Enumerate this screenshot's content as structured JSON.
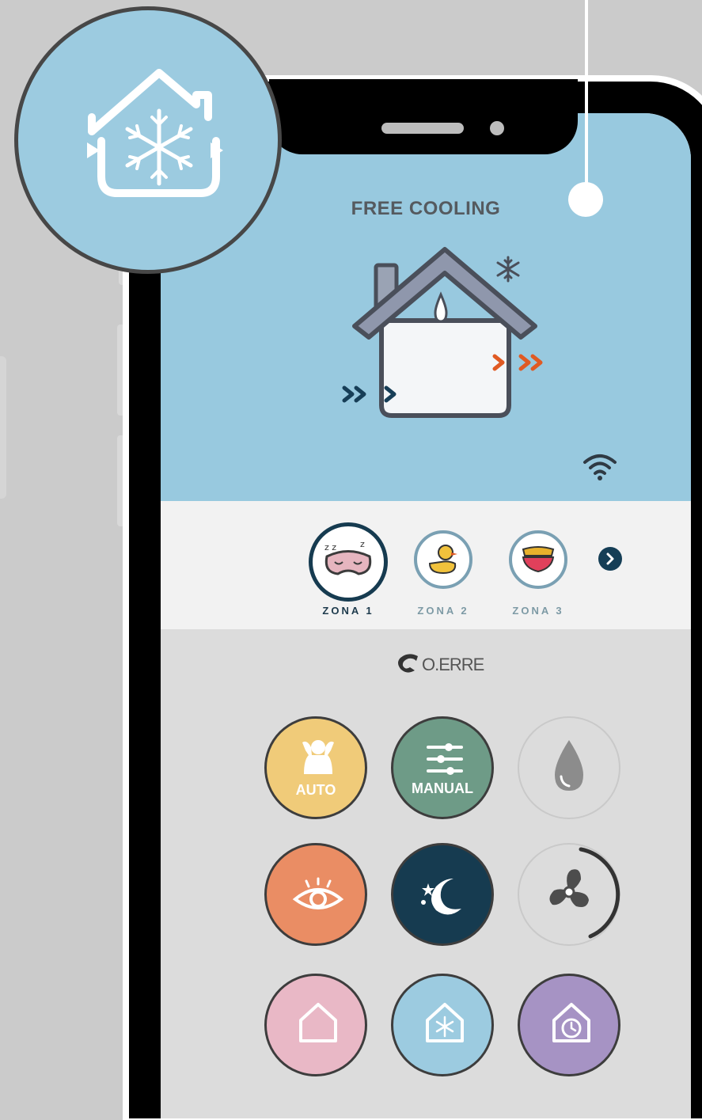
{
  "screen": {
    "title": "FREE COOLING"
  },
  "zones": [
    {
      "label": "ZONA 1",
      "icon": "sleep-mask-icon",
      "active": true
    },
    {
      "label": "ZONA 2",
      "icon": "rubber-duck-icon",
      "active": false
    },
    {
      "label": "ZONA 3",
      "icon": "bowls-icon",
      "active": false
    }
  ],
  "brand": {
    "logo_text": "O.ERRE"
  },
  "modes": {
    "auto": {
      "label": "AUTO",
      "icon": "person-relax-icon",
      "color": "#f0cb79"
    },
    "manual": {
      "label": "MANUAL",
      "icon": "sliders-icon",
      "color": "#6e9b87"
    },
    "dehumidify": {
      "icon": "water-drop-icon"
    },
    "eye": {
      "icon": "eye-icon",
      "color": "#ea8d64"
    },
    "night": {
      "icon": "moon-stars-icon",
      "color": "#163b50"
    },
    "fan": {
      "icon": "fan-icon"
    },
    "house_heat": {
      "icon": "house-icon",
      "color": "#e9b8c6"
    },
    "free_cooling": {
      "icon": "house-snowflake-icon",
      "color": "#9ccbe0"
    },
    "schedule": {
      "icon": "house-clock-icon",
      "color": "#a693c4"
    }
  },
  "colors": {
    "screen_top": "#98c9df",
    "zone_band": "#f2f2f2",
    "accent_dark": "#163b50",
    "arrow_orange": "#e05a23"
  }
}
